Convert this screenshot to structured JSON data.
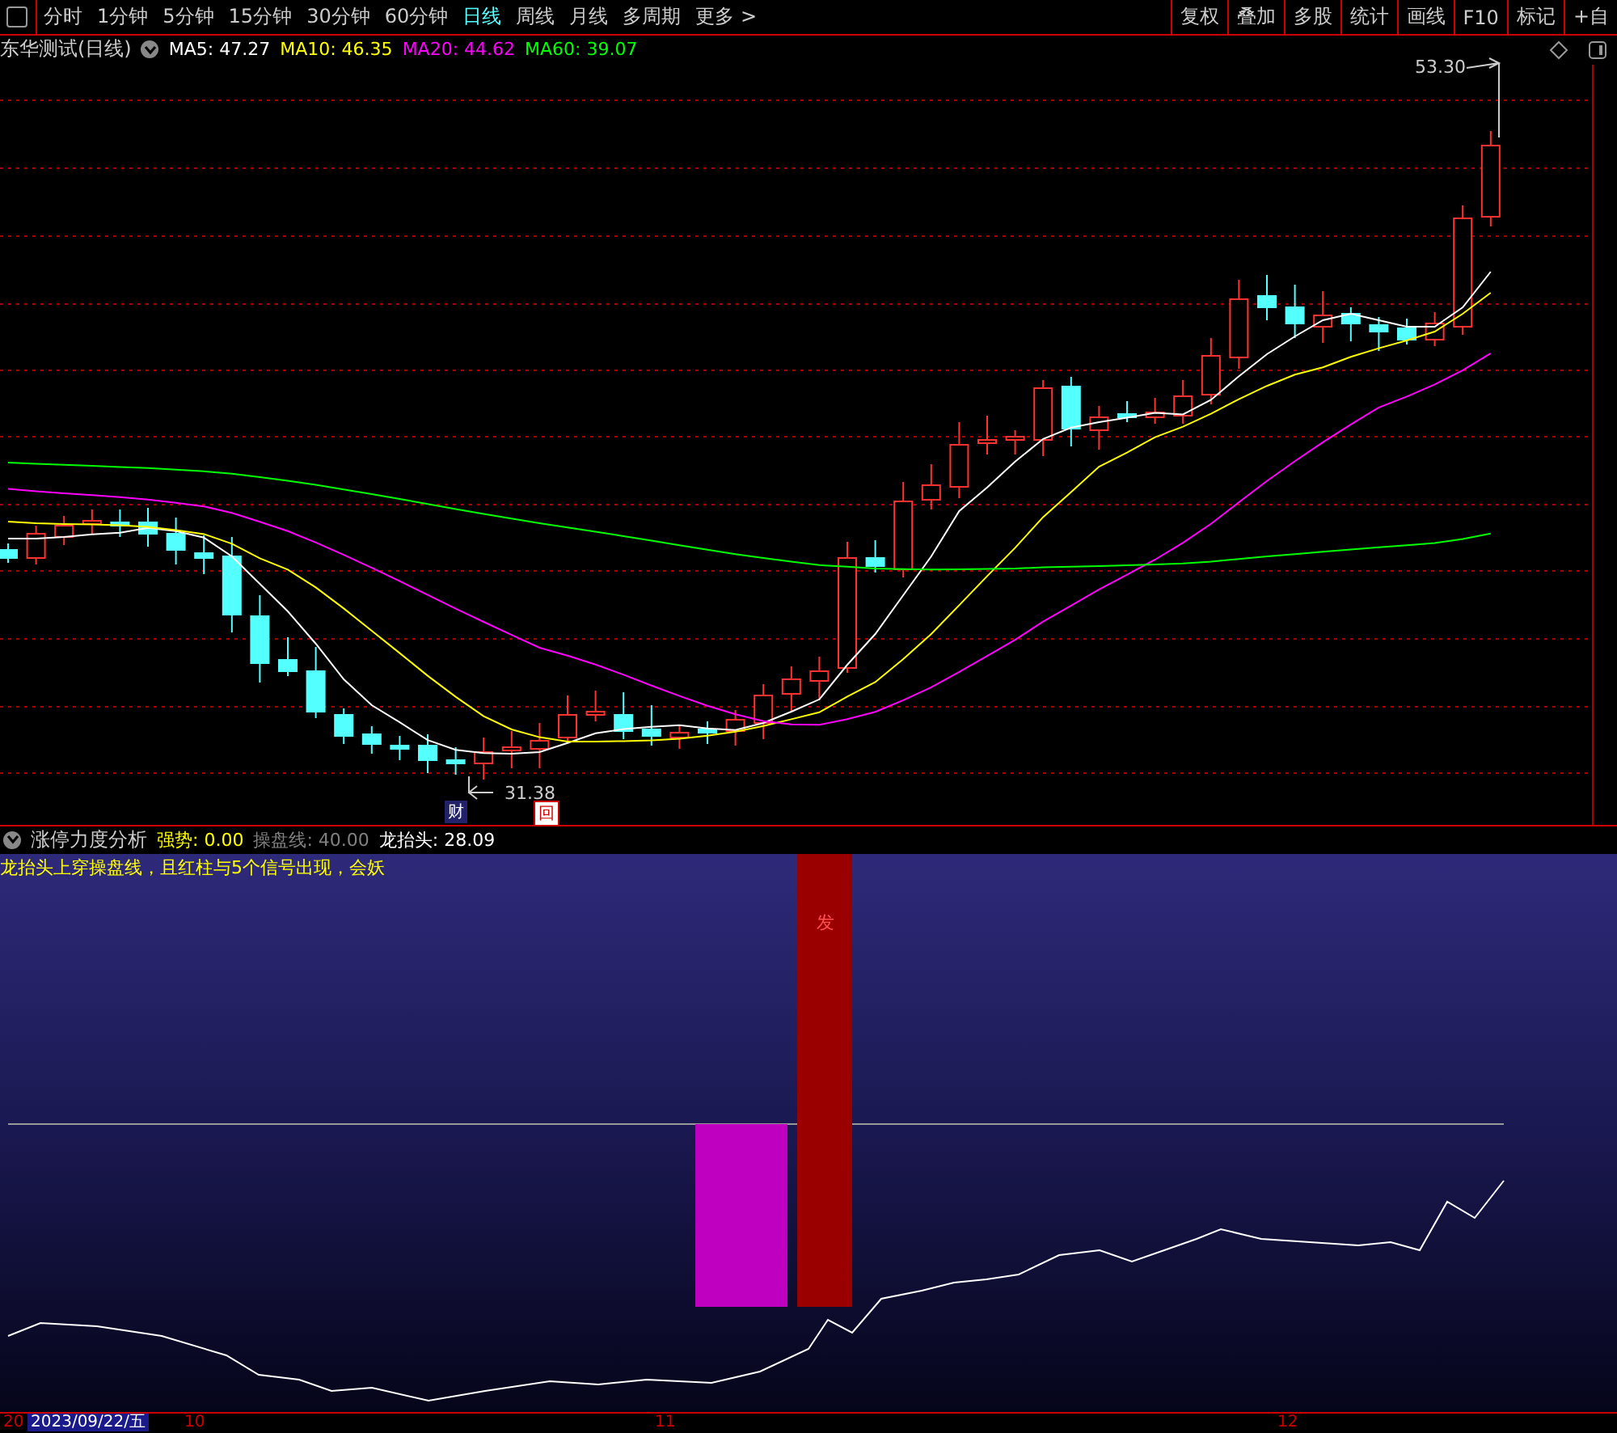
{
  "toolbar": {
    "periods": [
      {
        "label": "分时",
        "selected": false
      },
      {
        "label": "1分钟",
        "selected": false
      },
      {
        "label": "5分钟",
        "selected": false
      },
      {
        "label": "15分钟",
        "selected": false
      },
      {
        "label": "30分钟",
        "selected": false
      },
      {
        "label": "60分钟",
        "selected": false
      },
      {
        "label": "日线",
        "selected": true
      },
      {
        "label": "周线",
        "selected": false
      },
      {
        "label": "月线",
        "selected": false
      },
      {
        "label": "多周期",
        "selected": false
      },
      {
        "label": "更多 >",
        "selected": false
      }
    ],
    "actions": [
      "复权",
      "叠加",
      "多股",
      "统计",
      "画线",
      "F10",
      "标记",
      "+自"
    ]
  },
  "stock_title": "东华测试(日线)",
  "ma": [
    {
      "label": "MA5: 47.27",
      "color": "#ffffff"
    },
    {
      "label": "MA10: 46.35",
      "color": "#ffff00"
    },
    {
      "label": "MA20: 44.62",
      "color": "#ff00ff"
    },
    {
      "label": "MA60: 39.07",
      "color": "#00ff00"
    }
  ],
  "main_chart": {
    "high_label": "53.30",
    "low_label": "31.38",
    "markers": [
      "财",
      "回"
    ]
  },
  "indicator": {
    "name": "涨停力度分析",
    "values": [
      {
        "label": "强势: 0.00",
        "color": "#ffff00"
      },
      {
        "label": "操盘线: 40.00",
        "color": "#808080"
      },
      {
        "label": "龙抬头: 28.09",
        "color": "#ffffff"
      }
    ],
    "note": "龙抬头上穿操盘线，且红柱与5个信号出现，会妖",
    "signal": "发"
  },
  "axis": {
    "labels": [
      "20",
      "10",
      "11",
      "12"
    ],
    "cursor_date": "2023/09/22/五"
  }
}
